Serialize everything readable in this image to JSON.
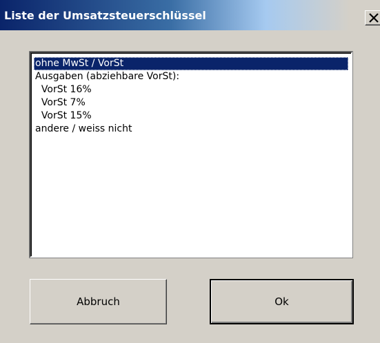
{
  "window": {
    "title": "Liste der Umsatzsteuerschlüssel",
    "close_label": "X"
  },
  "list": {
    "items": [
      "ohne MwSt / VorSt",
      "Ausgaben (abziehbare VorSt):",
      "  VorSt 16%",
      "  VorSt 7%",
      "  VorSt 15%",
      "andere / weiss nicht"
    ],
    "selected_index": 0
  },
  "buttons": {
    "cancel_label": "Abbruch",
    "ok_label": "Ok"
  },
  "colors": {
    "titlebar_start": "#0a246a",
    "titlebar_end": "#a6caf0",
    "dialog_background": "#d4d0c8",
    "selection_background": "#0a246a"
  },
  "icons": {
    "close": "close-icon"
  }
}
